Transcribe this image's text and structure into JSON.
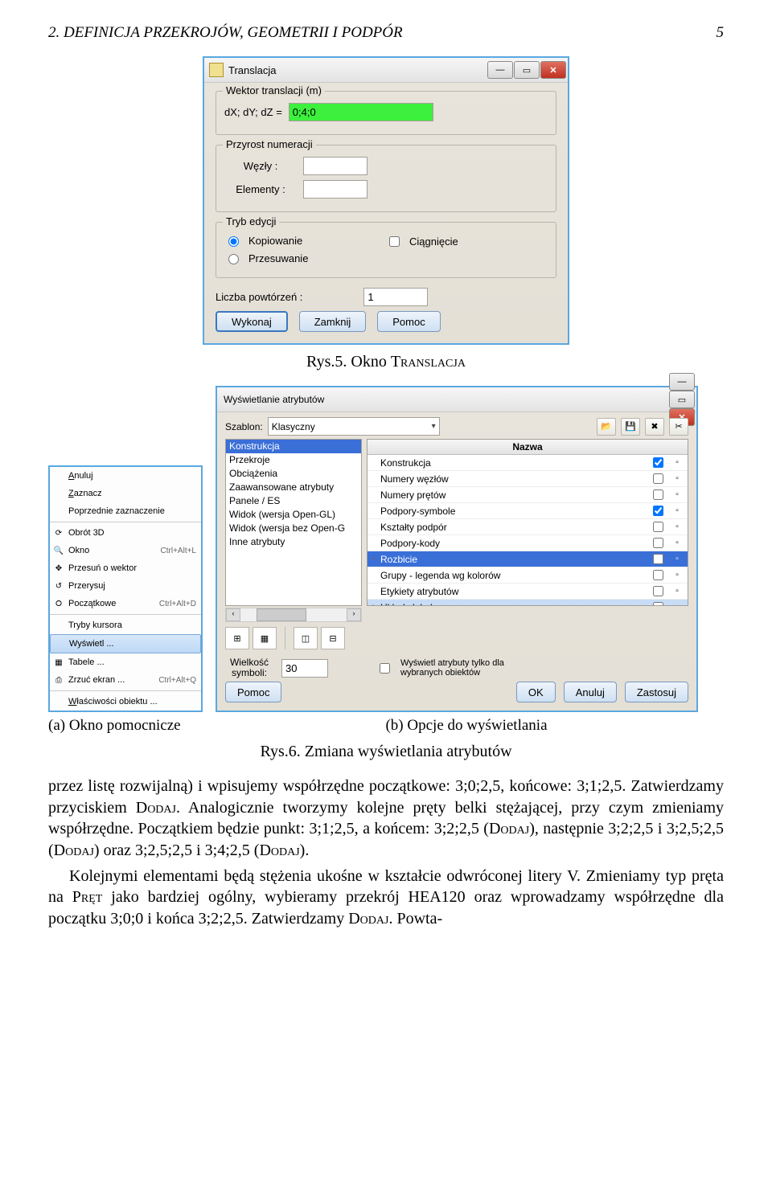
{
  "header": {
    "section": "2. DEFINICJA PRZEKROJÓW, GEOMETRII I PODPÓR",
    "page": "5"
  },
  "captions": {
    "fig5": "Rys.5. Okno",
    "fig5_sc": "Translacja",
    "fig6": "Rys.6. Zmiana wyświetlania atrybutów",
    "subA": "(a) Okno pomocnicze",
    "subB": "(b) Opcje do wyświetlania"
  },
  "dlg1": {
    "title": "Translacja",
    "g1": "Wektor translacji (m)",
    "dxdydz": "dX; dY; dZ  =",
    "val": "0;4;0",
    "g2": "Przyrost numeracji",
    "wezly": "Węzły :",
    "elementy": "Elementy :",
    "g3": "Tryb edycji",
    "kopiowanie": "Kopiowanie",
    "przesuwanie": "Przesuwanie",
    "ciagniecie": "Ciągnięcie",
    "liczba": "Liczba powtórzeń :",
    "liczba_val": "1",
    "b_wykonaj": "Wykonaj",
    "b_zamknij": "Zamknij",
    "b_pomoc": "Pomoc"
  },
  "ctx": {
    "items": [
      {
        "label": "Anuluj",
        "acc": "A",
        "ico": ""
      },
      {
        "label": "Zaznacz",
        "acc": "Z",
        "ico": ""
      },
      {
        "label": "Poprzednie zaznaczenie",
        "acc": "",
        "ico": ""
      }
    ],
    "items2": [
      {
        "label": "Obrót 3D",
        "ico": "⟳"
      },
      {
        "label": "Okno",
        "ico": "🔍",
        "sc": "Ctrl+Alt+L"
      },
      {
        "label": "Przesuń o wektor",
        "ico": "✥"
      },
      {
        "label": "Przerysuj",
        "ico": "↺"
      },
      {
        "label": "Początkowe",
        "ico": "⭘",
        "sc": "Ctrl+Alt+D"
      }
    ],
    "items3": [
      {
        "label": "Tryby kursora",
        "ico": ""
      },
      {
        "label": "Wyświetl ...",
        "ico": "",
        "hi": true
      },
      {
        "label": "Tabele ...",
        "ico": "▦"
      },
      {
        "label": "Zrzuć ekran ...",
        "ico": "⎙",
        "sc": "Ctrl+Alt+Q"
      }
    ],
    "items4": [
      {
        "label": "Właściwości obiektu ...",
        "acc": "W",
        "ico": ""
      }
    ]
  },
  "dlg2": {
    "title": "Wyświetlanie atrybutów",
    "szablon": "Szablon:",
    "szablon_val": "Klasyczny",
    "leftList": [
      "Konstrukcja",
      "Przekroje",
      "Obciążenia",
      "Zaawansowane atrybuty",
      "Panele / ES",
      "Widok (wersja Open-GL)",
      "Widok (wersja bez Open-G",
      "Inne atrybuty"
    ],
    "nazwa": "Nazwa",
    "rightList": [
      {
        "name": "Konstrukcja",
        "chk": true,
        "exp": ""
      },
      {
        "name": "Numery węzłów",
        "chk": false,
        "exp": ""
      },
      {
        "name": "Numery prętów",
        "chk": false,
        "exp": ""
      },
      {
        "name": "Podpory-symbole",
        "chk": true,
        "exp": ""
      },
      {
        "name": "Kształty podpór",
        "chk": false,
        "exp": ""
      },
      {
        "name": "Podpory-kody",
        "chk": false,
        "exp": ""
      },
      {
        "name": "Rozbicie",
        "chk": false,
        "exp": "+",
        "sel": true
      },
      {
        "name": "Grupy - legenda wg kolorów",
        "chk": false,
        "exp": ""
      },
      {
        "name": "Etykiety atrybutów",
        "chk": false,
        "exp": ""
      },
      {
        "name": "Układy lokalne",
        "chk": false,
        "exp": "+",
        "sel2": true
      }
    ],
    "wielkosc": "Wielkość symboli:",
    "wielkosc_val": "30",
    "wys_only": "Wyświetl atrybuty tylko dla wybranych obiektów",
    "b_pomoc": "Pomoc",
    "b_ok": "OK",
    "b_anuluj": "Anuluj",
    "b_zastosuj": "Zastosuj"
  },
  "body": {
    "p1a": "przez listę rozwijalną) i wpisujemy współrzędne początkowe: 3;0;2,5, końcowe: 3;1;2,5. Zatwierdzamy przyciskiem ",
    "p1b": ". Analogicznie tworzymy kolejne pręty belki stężającej, przy czym zmieniamy współrzędne. Początkiem będzie punkt: 3;1;2,5, a końcem: 3;2;2,5 (",
    "p1c": "), następnie 3;2;2,5 i 3;2,5;2,5 (",
    "p1d": ") oraz 3;2,5;2,5 i 3;4;2,5 (",
    "p1e": ").",
    "dodaj": "Dodaj",
    "p2a": "Kolejnymi elementami będą stężenia ukośne w kształcie odwróconej litery V. Zmieniamy typ pręta na ",
    "pret": "Pręt",
    "p2b": " jako bardziej ogólny, wybieramy przekrój HEA120 oraz wprowadzamy współrzędne dla początku 3;0;0 i końca 3;2;2,5. Zatwierdzamy ",
    "p2c": ". Powta-"
  }
}
